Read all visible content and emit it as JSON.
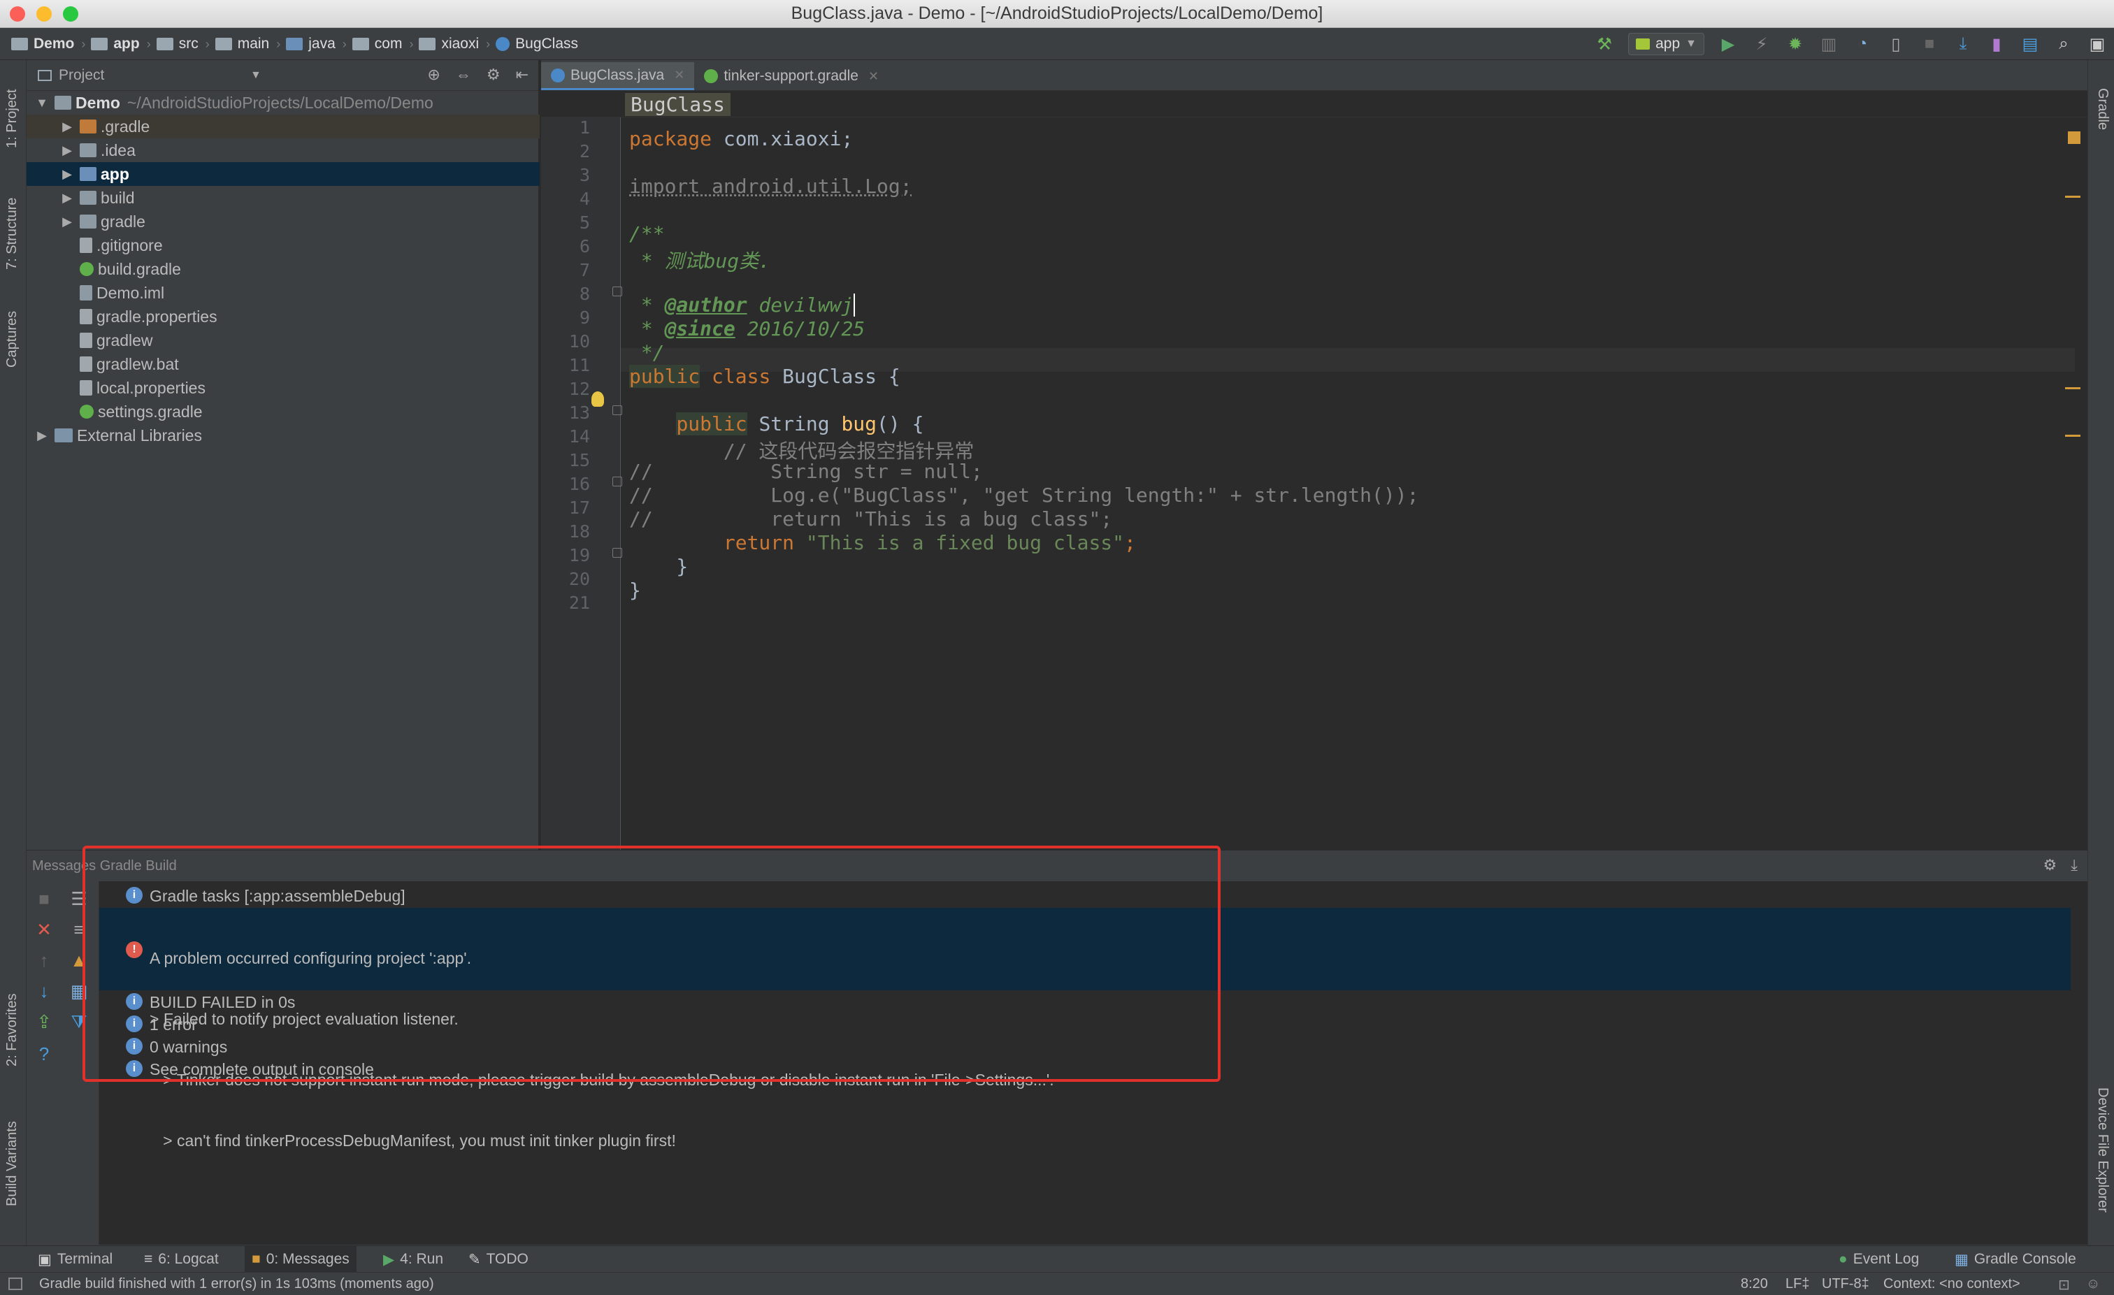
{
  "window": {
    "title": "BugClass.java - Demo - [~/AndroidStudioProjects/LocalDemo/Demo]"
  },
  "breadcrumbs": [
    "Demo",
    "app",
    "src",
    "main",
    "java",
    "com",
    "xiaoxi",
    "BugClass"
  ],
  "toolbar": {
    "run_config": "app"
  },
  "left_tabs": {
    "project": "1: Project",
    "structure": "7: Structure",
    "captures": "Captures",
    "favorites": "2: Favorites",
    "build_variants": "Build Variants"
  },
  "right_tabs": {
    "gradle": "Gradle",
    "device_explorer": "Device File Explorer"
  },
  "project_panel": {
    "title": "Project",
    "root": {
      "name": "Demo",
      "path": "~/AndroidStudioProjects/LocalDemo/Demo"
    },
    "items": [
      ".gradle",
      ".idea",
      "app",
      "build",
      "gradle",
      ".gitignore",
      "build.gradle",
      "Demo.iml",
      "gradle.properties",
      "gradlew",
      "gradlew.bat",
      "local.properties",
      "settings.gradle",
      "External Libraries"
    ]
  },
  "editor": {
    "tabs": [
      "BugClass.java",
      "tinker-support.gradle"
    ],
    "breadcrumb": "BugClass",
    "line_numbers": [
      "1",
      "2",
      "3",
      "4",
      "5",
      "6",
      "7",
      "8",
      "9",
      "10",
      "11",
      "12",
      "13",
      "14",
      "15",
      "16",
      "17",
      "18",
      "19",
      "20",
      "21"
    ],
    "code": {
      "l1_kw": "package",
      "l1_rest": " com.xiaoxi;",
      "l3": "import android.util.Log;",
      "l5": "/**",
      "l6": " * 测试bug类.",
      "l8_a": " * ",
      "l8_tag": "@author",
      "l8_b": " devilwwj",
      "l9_a": " * ",
      "l9_tag": "@since",
      "l9_b": " 2016/10/25",
      "l10": " */",
      "l11_kw": "public",
      "l11_kw2": " class",
      "l11_rest": " BugClass {",
      "l13_ind": "    ",
      "l13_kw": "public",
      "l13_type": " String ",
      "l13_fn": "bug",
      "l13_rest": "() {",
      "l14": "        // 这段代码会报空指针异常",
      "l15": "//          String str = null;",
      "l16": "//          Log.e(\"BugClass\", \"get String length:\" + str.length());",
      "l17": "//          return \"This is a bug class\";",
      "l18_ind": "        ",
      "l18_kw": "return",
      "l18_str": " \"This is a fixed bug class\"",
      "l18_end": ";",
      "l19": "    }",
      "l20": "}"
    }
  },
  "messages": {
    "header": "Messages Gradle Build",
    "task": "Gradle tasks [:app:assembleDebug]",
    "error_lines": [
      "A problem occurred configuring project ':app'.",
      "> Failed to notify project evaluation listener.",
      "   > Tinker does not support instant run mode, please trigger build by assembleDebug or disable instant run in 'File->Settings...'.",
      "   > can't find tinkerProcessDebugManifest, you must init tinker plugin first!"
    ],
    "info": [
      "BUILD FAILED in 0s",
      "1 error",
      "0 warnings",
      "See complete output in console"
    ]
  },
  "bottom_tabs": {
    "terminal": "Terminal",
    "logcat": "6: Logcat",
    "messages": "0: Messages",
    "run": "4: Run",
    "todo": "TODO",
    "event_log": "Event Log",
    "gradle_console": "Gradle Console"
  },
  "status": {
    "text": "Gradle build finished with 1 error(s) in 1s 103ms (moments ago)",
    "position": "8:20",
    "line_sep": "LF‡",
    "encoding": "UTF-8‡",
    "context": "Context: <no context>"
  },
  "colors": {
    "accent": "#4a88c7",
    "error": "#e2302a",
    "keyword": "#cc7832",
    "string": "#6a8759"
  }
}
